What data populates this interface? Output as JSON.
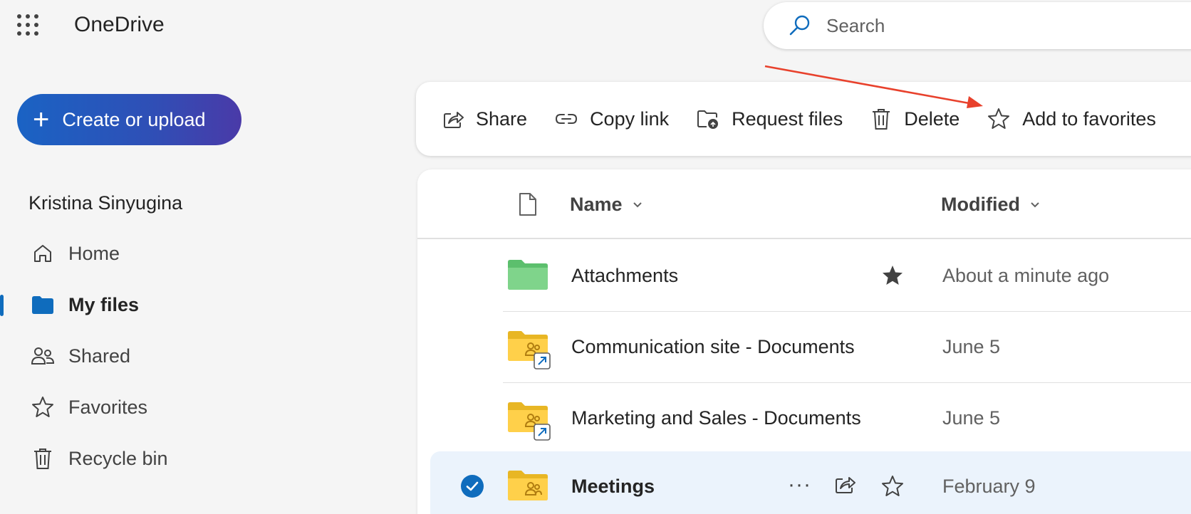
{
  "app": {
    "title": "OneDrive"
  },
  "search": {
    "placeholder": "Search"
  },
  "sidebar": {
    "create_label": "Create or upload",
    "user_name": "Kristina Sinyugina",
    "items": [
      {
        "label": "Home",
        "icon": "home-icon"
      },
      {
        "label": "My files",
        "icon": "folder-icon",
        "active": true
      },
      {
        "label": "Shared",
        "icon": "people-icon"
      },
      {
        "label": "Favorites",
        "icon": "star-icon"
      },
      {
        "label": "Recycle bin",
        "icon": "trash-icon"
      }
    ]
  },
  "command_bar": {
    "share": "Share",
    "copy_link": "Copy link",
    "request_files": "Request files",
    "delete": "Delete",
    "add_to_favorites": "Add to favorites"
  },
  "list": {
    "columns": {
      "name": "Name",
      "modified": "Modified"
    },
    "rows": [
      {
        "name": "Attachments",
        "modified": "About a minute ago",
        "type": "folder-green",
        "favorite": true
      },
      {
        "name": "Communication site - Documents",
        "modified": "June 5",
        "type": "shared-folder-shortcut"
      },
      {
        "name": "Marketing and Sales - Documents",
        "modified": "June 5",
        "type": "shared-folder-shortcut"
      },
      {
        "name": "Meetings",
        "modified": "February 9",
        "type": "shared-folder",
        "selected": true
      }
    ]
  },
  "colors": {
    "accent": "#0f6cbd",
    "selected_row": "#ebf3fc",
    "annotation_arrow": "#e8412c"
  }
}
